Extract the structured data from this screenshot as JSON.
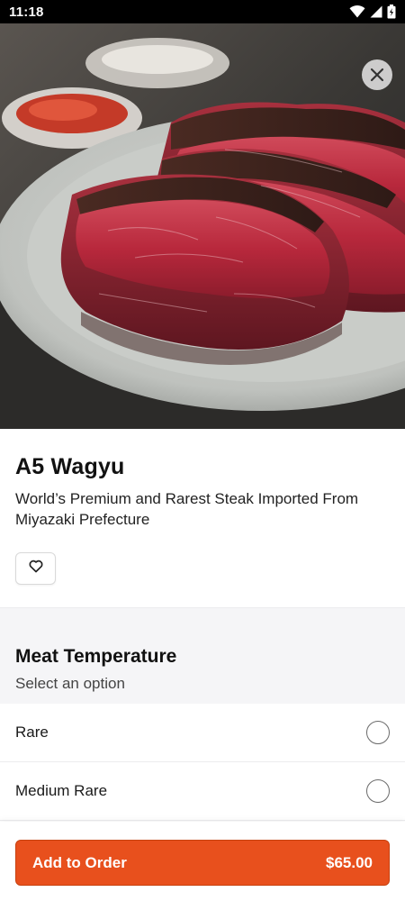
{
  "status_bar": {
    "time": "11:18",
    "icons": [
      "wifi-icon",
      "cellular-signal-icon",
      "battery-icon"
    ]
  },
  "hero": {
    "image_description": "grilled-wagyu-steak-photo",
    "close_icon": "close-icon"
  },
  "item": {
    "title": "A5 Wagyu",
    "description": "World’s Premium and Rarest Steak Imported From Miyazaki Prefecture",
    "favorite_icon": "heart-outline-icon"
  },
  "options": {
    "title": "Meat Temperature",
    "subtitle": "Select an option",
    "choices": [
      {
        "label": "Rare",
        "selected": false
      },
      {
        "label": "Medium Rare",
        "selected": false
      }
    ]
  },
  "cta": {
    "label": "Add to Order",
    "price": "$65.00"
  },
  "colors": {
    "accent": "#e8501d",
    "section_bg": "#f5f5f7"
  }
}
